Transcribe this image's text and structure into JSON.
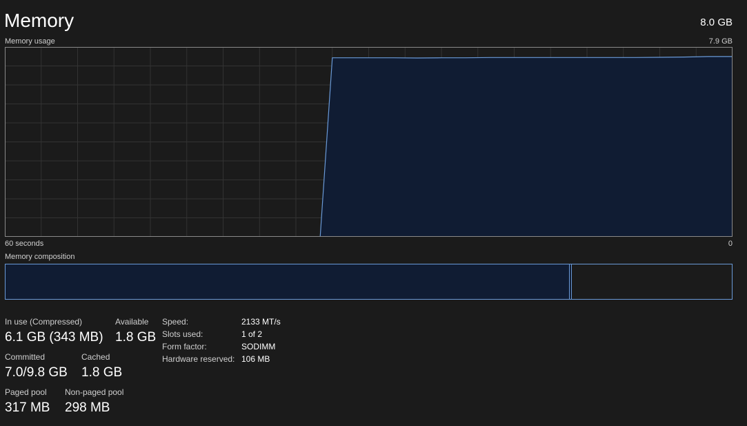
{
  "header": {
    "title": "Memory",
    "total": "8.0 GB"
  },
  "usage_graph": {
    "label": "Memory usage",
    "max_label": "7.9 GB",
    "time_start_label": "60 seconds",
    "time_end_label": "0",
    "line_color": "#6a9ad8",
    "fill_color": "#101c33",
    "grid_color": "#333333"
  },
  "chart_data": {
    "type": "area",
    "x": [
      60,
      55,
      50,
      45,
      40,
      35,
      34,
      33,
      32,
      30,
      28,
      26,
      24,
      22,
      20,
      18,
      16,
      14,
      12,
      10,
      8,
      6,
      4,
      2,
      0
    ],
    "series": [
      {
        "values": [
          null,
          null,
          null,
          null,
          null,
          null,
          0,
          7.45,
          7.45,
          7.45,
          7.45,
          7.44,
          7.45,
          7.45,
          7.46,
          7.46,
          7.46,
          7.46,
          7.46,
          7.46,
          7.46,
          7.47,
          7.48,
          7.5,
          7.5
        ]
      }
    ],
    "xlabel": "",
    "ylabel": "",
    "ylim": [
      0,
      7.9
    ],
    "xlim": [
      60,
      0
    ]
  },
  "composition": {
    "label": "Memory composition",
    "in_use_fraction": 0.777,
    "modified_fraction": 0.003
  },
  "stats": {
    "in_use_label": "In use (Compressed)",
    "in_use_value": "6.1 GB (343 MB)",
    "available_label": "Available",
    "available_value": "1.8 GB",
    "committed_label": "Committed",
    "committed_value": "7.0/9.8 GB",
    "cached_label": "Cached",
    "cached_value": "1.8 GB",
    "paged_pool_label": "Paged pool",
    "paged_pool_value": "317 MB",
    "non_paged_pool_label": "Non-paged pool",
    "non_paged_pool_value": "298 MB"
  },
  "specs": {
    "speed_label": "Speed:",
    "speed_value": "2133 MT/s",
    "slots_label": "Slots used:",
    "slots_value": "1 of 2",
    "form_factor_label": "Form factor:",
    "form_factor_value": "SODIMM",
    "hw_reserved_label": "Hardware reserved:",
    "hw_reserved_value": "106 MB"
  }
}
